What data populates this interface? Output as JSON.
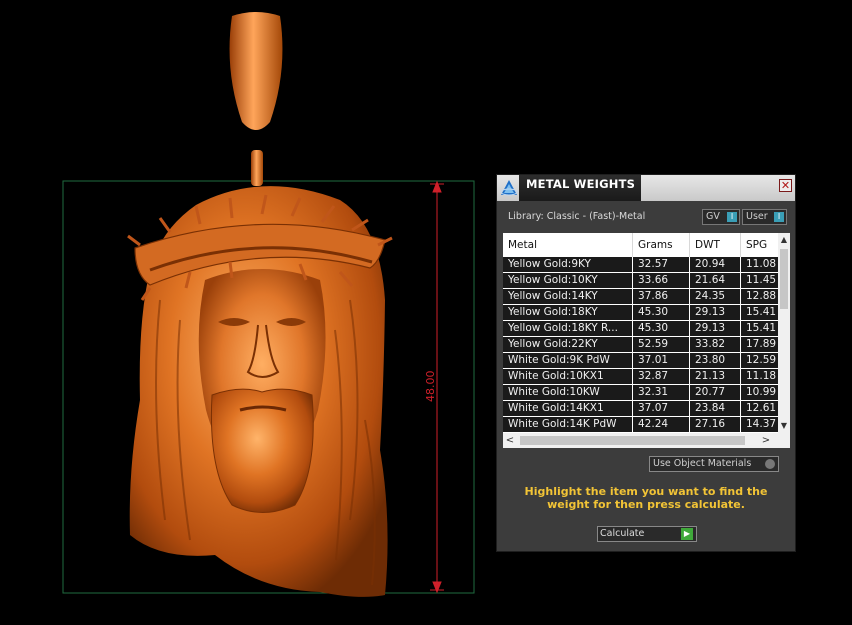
{
  "viewport": {
    "dimension_label": "48.00"
  },
  "panel": {
    "title": "METAL WEIGHTS",
    "close_label": "✕",
    "library": "Library: Classic - (Fast)-Metal",
    "gv_label": "GV",
    "user_label": "User",
    "toggle_glyph": "I",
    "columns": [
      "Metal",
      "Grams",
      "DWT",
      "SPG"
    ],
    "rows": [
      [
        "Yellow Gold:9KY",
        "32.57",
        "20.94",
        "11.08"
      ],
      [
        "Yellow Gold:10KY",
        "33.66",
        "21.64",
        "11.45"
      ],
      [
        "Yellow Gold:14KY",
        "37.86",
        "24.35",
        "12.88"
      ],
      [
        "Yellow Gold:18KY",
        "45.30",
        "29.13",
        "15.41"
      ],
      [
        "Yellow Gold:18KY R...",
        "45.30",
        "29.13",
        "15.41"
      ],
      [
        "Yellow Gold:22KY",
        "52.59",
        "33.82",
        "17.89"
      ],
      [
        "White Gold:9K PdW",
        "37.01",
        "23.80",
        "12.59"
      ],
      [
        "White Gold:10KX1",
        "32.87",
        "21.13",
        "11.18"
      ],
      [
        "White Gold:10KW",
        "32.31",
        "20.77",
        "10.99"
      ],
      [
        "White Gold:14KX1",
        "37.07",
        "23.84",
        "12.61"
      ],
      [
        "White Gold:14K PdW",
        "42.24",
        "27.16",
        "14.37"
      ]
    ],
    "use_object_materials": "Use Object Materials",
    "message": "Highlight the item you want to find the weight for then press calculate.",
    "calculate_label": "Calculate",
    "scroll_left": "<",
    "scroll_right": ">",
    "scroll_up": "▲",
    "scroll_down": "▼",
    "play_glyph": "▶"
  },
  "colors": {
    "model_base": "#d2601a",
    "model_highlight": "#ffab5c",
    "bounding_box": "#1f6b3f",
    "dimension": "#d0202a",
    "message_text": "#f2c436"
  }
}
